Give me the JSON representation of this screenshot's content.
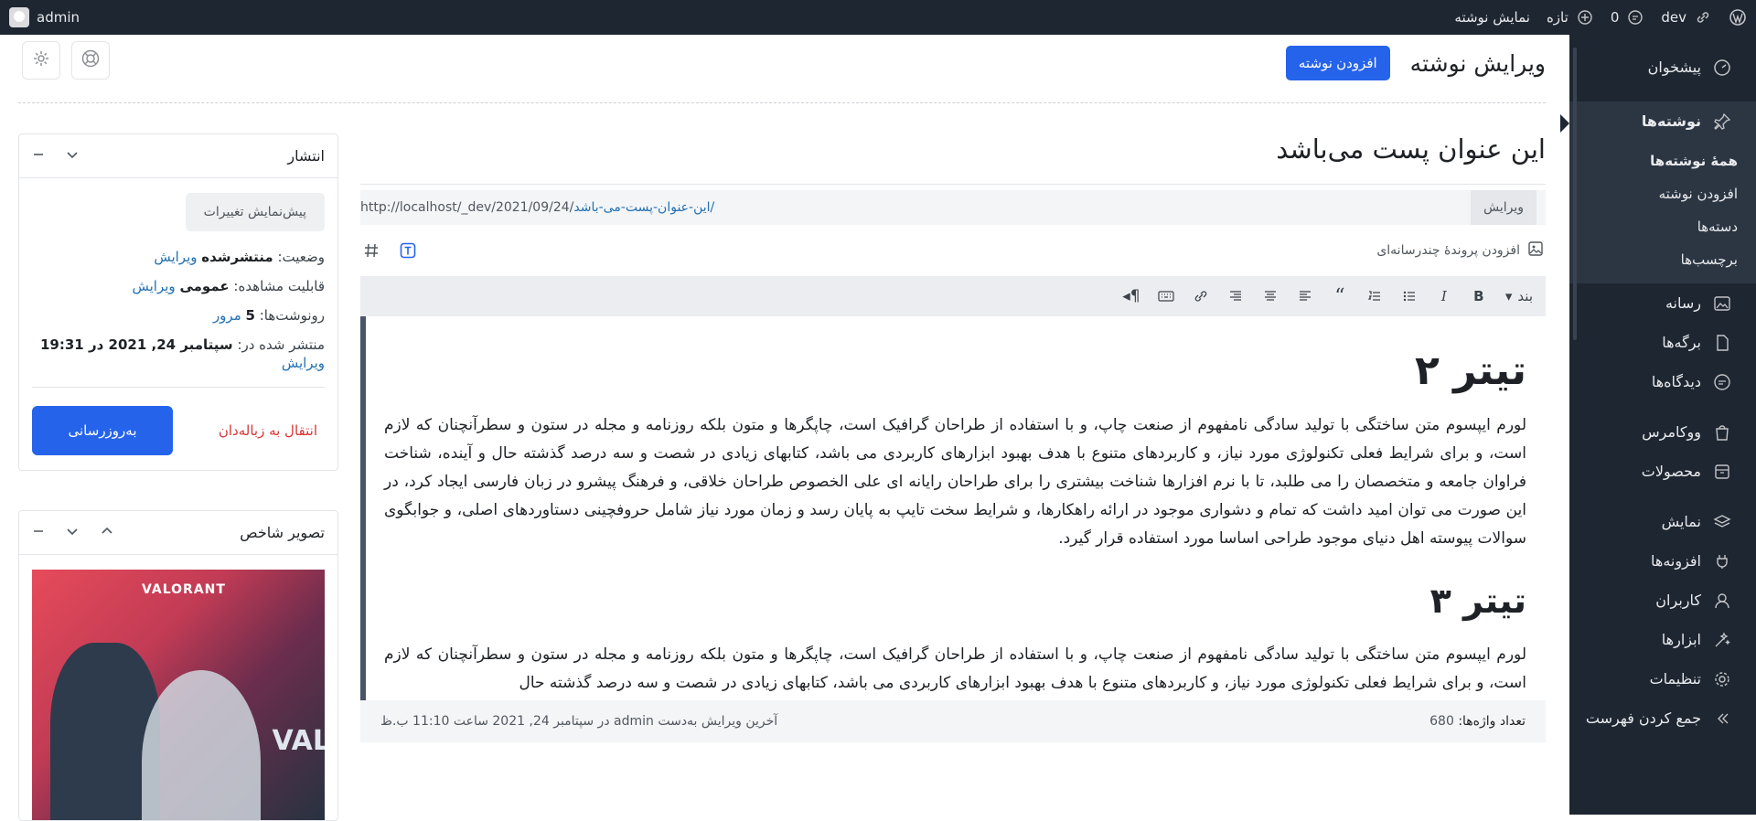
{
  "adminbar": {
    "user": "admin",
    "view_post": "نمایش نوشته",
    "new": "تازه",
    "comments_count": "0",
    "site": "dev"
  },
  "sidebar": {
    "items": [
      {
        "label": "پیشخوان",
        "icon": "dashboard-icon"
      },
      {
        "label": "نوشته‌ها",
        "icon": "pin-icon"
      },
      {
        "label": "رسانه",
        "icon": "media-icon"
      },
      {
        "label": "برگه‌ها",
        "icon": "page-icon"
      },
      {
        "label": "دیدگاه‌ها",
        "icon": "comment-icon"
      },
      {
        "label": "ووکامرس",
        "icon": "bag-icon"
      },
      {
        "label": "محصولات",
        "icon": "archive-icon"
      },
      {
        "label": "نمایش",
        "icon": "layers-icon"
      },
      {
        "label": "افزونه‌ها",
        "icon": "plugin-icon"
      },
      {
        "label": "کاربران",
        "icon": "user-icon"
      },
      {
        "label": "ابزارها",
        "icon": "tools-icon"
      },
      {
        "label": "تنظیمات",
        "icon": "settings-icon"
      },
      {
        "label": "جمع کردن فهرست",
        "icon": "collapse-icon"
      }
    ],
    "submenu": [
      "همهٔ نوشته‌ها",
      "افزودن نوشته",
      "دسته‌ها",
      "برچسب‌ها"
    ]
  },
  "page": {
    "title": "ویرایش نوشته",
    "add_new": "افزودن نوشته"
  },
  "editor": {
    "post_title": "این عنوان پست می‌باشد",
    "permalink_base": "http://localhost/_dev/2021/09/24/",
    "permalink_slug": "این-عنوان-پست-می-باشد",
    "permalink_end": "/",
    "permalink_edit": "ویرایش",
    "add_media": "افزودن پروندهٔ چندرسانه‌ای",
    "format": "بند",
    "heading_2": "تیتر ۲",
    "paragraph_1": "لورم ایپسوم متن ساختگی با تولید سادگی نامفهوم از صنعت چاپ، و با استفاده از طراحان گرافیک است، چاپگرها و متون بلکه روزنامه و مجله در ستون و سطرآنچنان که لازم است، و برای شرایط فعلی تکنولوژی مورد نیاز، و کاربردهای متنوع با هدف بهبود ابزارهای کاربردی می باشد، کتابهای زیادی در شصت و سه درصد گذشته حال و آینده، شناخت فراوان جامعه و متخصصان را می طلبد، تا با نرم افزارها شناخت بیشتری را برای طراحان رایانه ای علی الخصوص طراحان خلاقی، و فرهنگ پیشرو در زبان فارسی ایجاد کرد، در این صورت می توان امید داشت که تمام و دشواری موجود در ارائه راهکارها، و شرایط سخت تایپ به پایان رسد و زمان مورد نیاز شامل حروفچینی دستاوردهای اصلی، و جوابگوی سوالات پیوسته اهل دنیای موجود طراحی اساسا مورد استفاده قرار گیرد.",
    "heading_3": "تیتر ۳",
    "paragraph_2": "لورم ایپسوم متن ساختگی با تولید سادگی نامفهوم از صنعت چاپ، و با استفاده از طراحان گرافیک است، چاپگرها و متون بلکه روزنامه و مجله در ستون و سطرآنچنان که لازم است، و برای شرایط فعلی تکنولوژی مورد نیاز، و کاربردهای متنوع با هدف بهبود ابزارهای کاربردی می باشد، کتابهای زیادی در شصت و سه درصد گذشته حال",
    "word_count_label": "تعداد واژه‌ها:",
    "word_count": "680",
    "last_edit": "آخرین ویرایش به‌دست admin در سپتامبر 24, 2021 ساعت 11:10 ب.ظ"
  },
  "publish": {
    "title": "انتشار",
    "preview": "پیش‌نمایش تغییرات",
    "status_label": "وضعیت:",
    "status_value": "منتشرشده",
    "visibility_label": "قابلیت مشاهده:",
    "visibility_value": "عمومی",
    "revisions_label": "رونوشت‌ها:",
    "revisions_value": "5",
    "revisions_link": "مرور",
    "published_label": "منتشر شده در:",
    "published_value": "سپتامبر 24, 2021 در 19:31",
    "edit": "ویرایش",
    "trash": "انتقال به زباله‌دان",
    "update": "به‌روزرسانی"
  },
  "featured": {
    "title": "تصویر شاخص",
    "logo_text": "VALORANT",
    "logo_text_2": "VAL"
  }
}
